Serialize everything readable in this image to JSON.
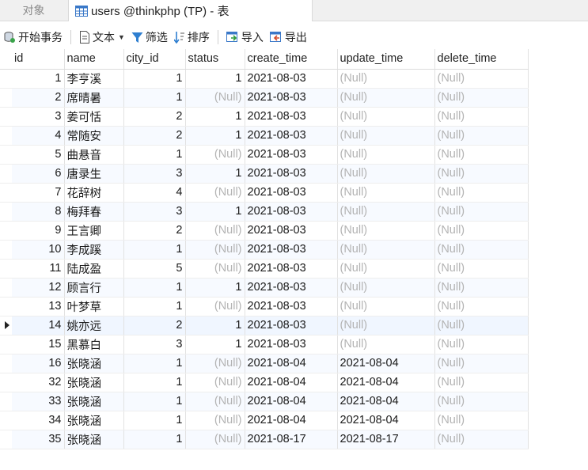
{
  "tabs": {
    "objects": "对象",
    "active": "users @thinkphp (TP) - 表"
  },
  "toolbar": {
    "begin_transaction": "开始事务",
    "text": "文本",
    "filter": "筛选",
    "sort": "排序",
    "import": "导入",
    "export": "导出"
  },
  "columns": [
    "id",
    "name",
    "city_id",
    "status",
    "create_time",
    "update_time",
    "delete_time"
  ],
  "null_text": "(Null)",
  "selected_row_index": 13,
  "rows": [
    {
      "id": "1",
      "name": "李亨溪",
      "city_id": "1",
      "status": "1",
      "create_time": "2021-08-03",
      "update_time": null,
      "delete_time": null
    },
    {
      "id": "2",
      "name": "席晴暑",
      "city_id": "1",
      "status": null,
      "create_time": "2021-08-03",
      "update_time": null,
      "delete_time": null
    },
    {
      "id": "3",
      "name": "姜可恬",
      "city_id": "2",
      "status": "1",
      "create_time": "2021-08-03",
      "update_time": null,
      "delete_time": null
    },
    {
      "id": "4",
      "name": "常随安",
      "city_id": "2",
      "status": "1",
      "create_time": "2021-08-03",
      "update_time": null,
      "delete_time": null
    },
    {
      "id": "5",
      "name": "曲悬音",
      "city_id": "1",
      "status": null,
      "create_time": "2021-08-03",
      "update_time": null,
      "delete_time": null
    },
    {
      "id": "6",
      "name": "唐录生",
      "city_id": "3",
      "status": "1",
      "create_time": "2021-08-03",
      "update_time": null,
      "delete_time": null
    },
    {
      "id": "7",
      "name": "花辞树",
      "city_id": "4",
      "status": null,
      "create_time": "2021-08-03",
      "update_time": null,
      "delete_time": null
    },
    {
      "id": "8",
      "name": "梅拜春",
      "city_id": "3",
      "status": "1",
      "create_time": "2021-08-03",
      "update_time": null,
      "delete_time": null
    },
    {
      "id": "9",
      "name": "王言卿",
      "city_id": "2",
      "status": null,
      "create_time": "2021-08-03",
      "update_time": null,
      "delete_time": null
    },
    {
      "id": "10",
      "name": "李成蹊",
      "city_id": "1",
      "status": null,
      "create_time": "2021-08-03",
      "update_time": null,
      "delete_time": null
    },
    {
      "id": "11",
      "name": "陆成盈",
      "city_id": "5",
      "status": null,
      "create_time": "2021-08-03",
      "update_time": null,
      "delete_time": null
    },
    {
      "id": "12",
      "name": "顾言行",
      "city_id": "1",
      "status": "1",
      "create_time": "2021-08-03",
      "update_time": null,
      "delete_time": null
    },
    {
      "id": "13",
      "name": "叶梦草",
      "city_id": "1",
      "status": null,
      "create_time": "2021-08-03",
      "update_time": null,
      "delete_time": null
    },
    {
      "id": "14",
      "name": "姚亦远",
      "city_id": "2",
      "status": "1",
      "create_time": "2021-08-03",
      "update_time": null,
      "delete_time": null
    },
    {
      "id": "15",
      "name": "黑慕白",
      "city_id": "3",
      "status": "1",
      "create_time": "2021-08-03",
      "update_time": null,
      "delete_time": null
    },
    {
      "id": "16",
      "name": "张晓涵",
      "city_id": "1",
      "status": null,
      "create_time": "2021-08-04",
      "update_time": "2021-08-04",
      "delete_time": null
    },
    {
      "id": "32",
      "name": "张晓涵",
      "city_id": "1",
      "status": null,
      "create_time": "2021-08-04",
      "update_time": "2021-08-04",
      "delete_time": null
    },
    {
      "id": "33",
      "name": "张晓涵",
      "city_id": "1",
      "status": null,
      "create_time": "2021-08-04",
      "update_time": "2021-08-04",
      "delete_time": null
    },
    {
      "id": "34",
      "name": "张晓涵",
      "city_id": "1",
      "status": null,
      "create_time": "2021-08-04",
      "update_time": "2021-08-04",
      "delete_time": null
    },
    {
      "id": "35",
      "name": "张晓涵",
      "city_id": "1",
      "status": null,
      "create_time": "2021-08-17",
      "update_time": "2021-08-17",
      "delete_time": null
    }
  ]
}
